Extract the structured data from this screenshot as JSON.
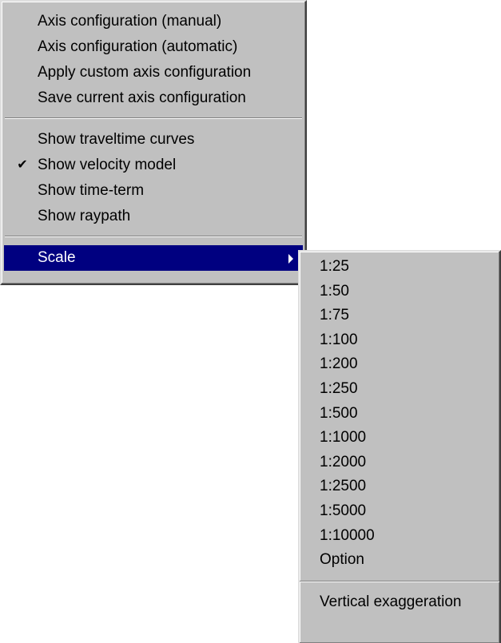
{
  "main_menu": {
    "group1": [
      "Axis configuration (manual)",
      "Axis configuration (automatic)",
      "Apply custom axis configuration",
      "Save current axis configuration"
    ],
    "group2": [
      {
        "label": "Show traveltime curves",
        "checked": false
      },
      {
        "label": "Show velocity model",
        "checked": true
      },
      {
        "label": "Show time-term",
        "checked": false
      },
      {
        "label": "Show raypath",
        "checked": false
      }
    ],
    "check_glyph": "✔",
    "scale_label": "Scale",
    "scale_selected": true
  },
  "scale_submenu": {
    "items": [
      "1:25",
      "1:50",
      "1:75",
      "1:100",
      "1:200",
      "1:250",
      "1:500",
      "1:1000",
      "1:2000",
      "1:2500",
      "1:5000",
      "1:10000",
      "Option"
    ],
    "vertical_exaggeration_label": "Vertical exaggeration"
  },
  "colors": {
    "menu_bg": "#c0c0c0",
    "highlight": "#000080",
    "highlight_text": "#ffffff"
  },
  "icons": {
    "check": "check-icon",
    "submenu_arrow": "submenu-arrow-icon"
  }
}
